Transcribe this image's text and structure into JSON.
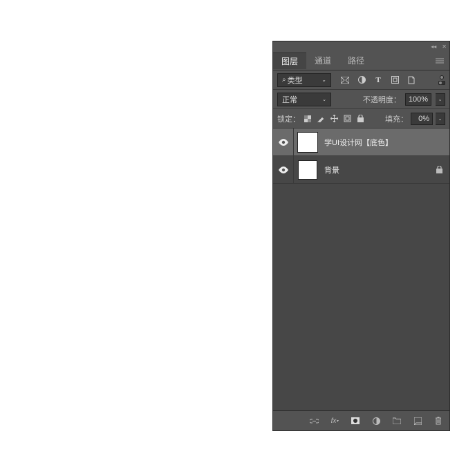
{
  "tabs": {
    "layers": "图层",
    "channels": "通道",
    "paths": "路径"
  },
  "filter": {
    "kind_label": "类型"
  },
  "blend": {
    "mode": "正常",
    "opacity_label": "不透明度：",
    "opacity_value": "100%"
  },
  "lock": {
    "label": "锁定：",
    "fill_label": "填充：",
    "fill_value": "0%"
  },
  "layers": [
    {
      "name": "学UI设计网【底色】",
      "visible": true,
      "locked": false
    },
    {
      "name": "背景",
      "visible": true,
      "locked": true
    }
  ]
}
